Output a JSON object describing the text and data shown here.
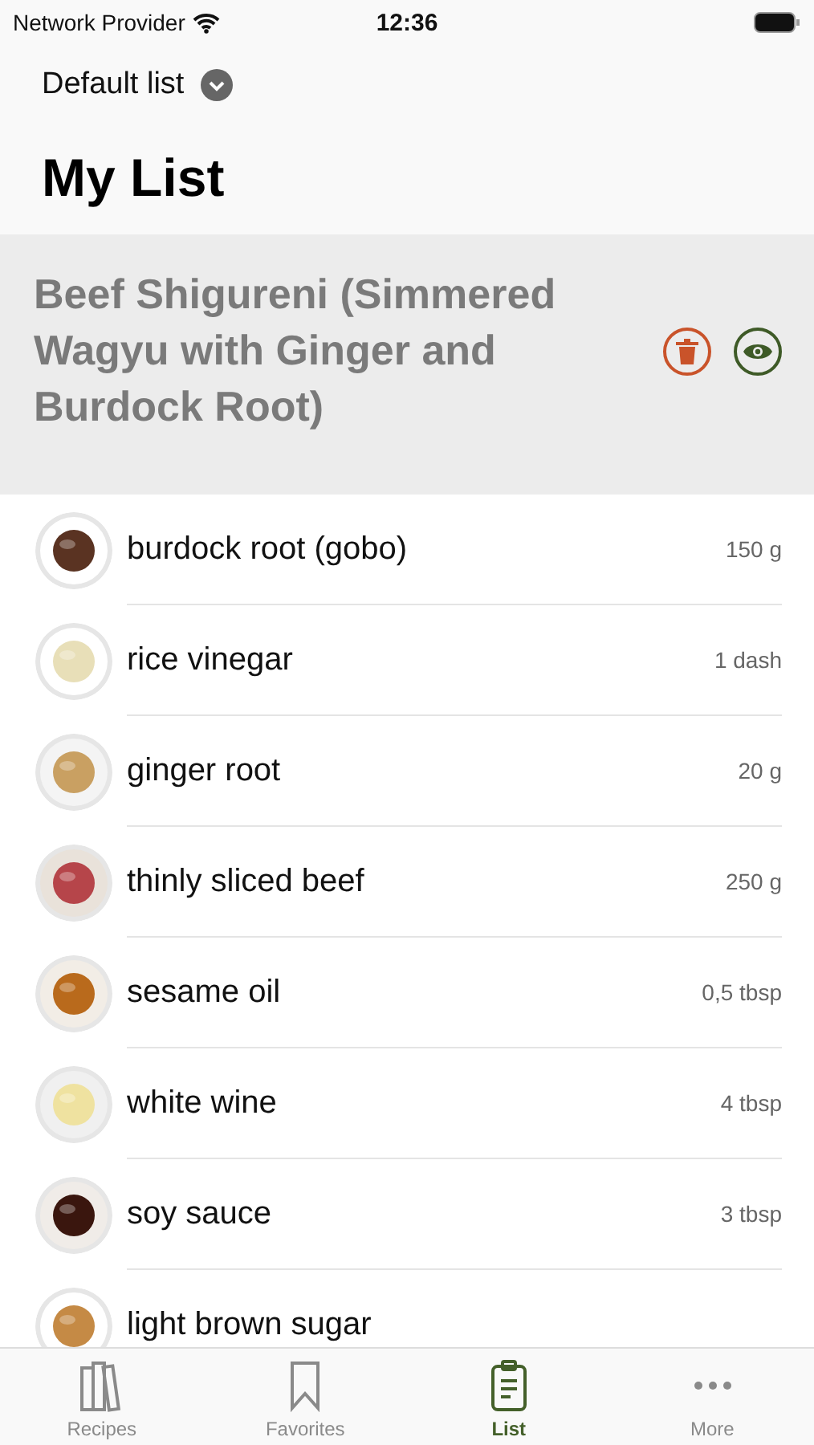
{
  "status_bar": {
    "carrier": "Network Provider",
    "time": "12:36"
  },
  "list_picker": {
    "label": "Default list"
  },
  "title": "My List",
  "recipe": {
    "title": "Beef Shigureni (Simmered Wagyu with Ginger and Burdock Root)"
  },
  "ingredients": [
    {
      "name": "burdock root (gobo)",
      "amount": "150 g"
    },
    {
      "name": "rice vinegar",
      "amount": "1 dash"
    },
    {
      "name": "ginger root",
      "amount": "20 g"
    },
    {
      "name": "thinly sliced beef",
      "amount": "250 g"
    },
    {
      "name": "sesame oil",
      "amount": "0,5 tbsp"
    },
    {
      "name": "white wine",
      "amount": "4 tbsp"
    },
    {
      "name": "soy sauce",
      "amount": "3 tbsp"
    },
    {
      "name": "light brown sugar"
    }
  ],
  "tabs": [
    {
      "label": "Recipes",
      "kind": "books",
      "selected": false
    },
    {
      "label": "Favorites",
      "kind": "bookmark",
      "selected": false
    },
    {
      "label": "List",
      "kind": "clipboard",
      "selected": true
    },
    {
      "label": "More",
      "kind": "dots",
      "selected": false
    }
  ]
}
